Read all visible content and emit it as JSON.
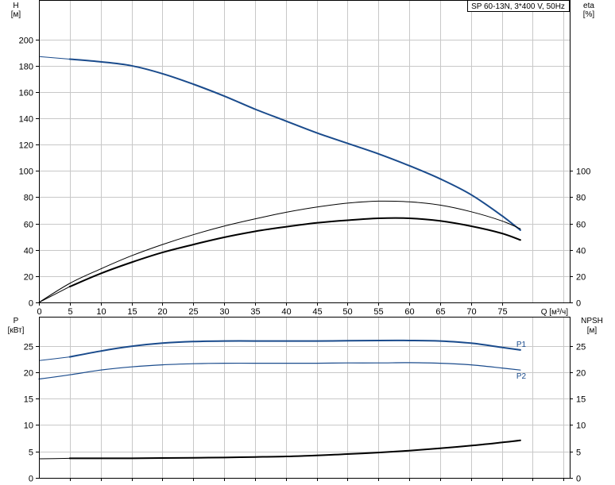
{
  "title": "SP 60-13N, 3*400 V, 50Hz",
  "colors": {
    "blue": "#1a4b8c",
    "black": "#000000",
    "grid": "#c8c8c8"
  },
  "chart_data": [
    {
      "id": "top",
      "type": "line",
      "x_axis": {
        "label": "Q [м³/ч]",
        "range": [
          0,
          86
        ],
        "ticks": [
          0,
          5,
          10,
          15,
          20,
          25,
          30,
          35,
          40,
          45,
          50,
          55,
          60,
          65,
          70,
          75
        ]
      },
      "y_left": {
        "label_line1": "H",
        "label_line2": "[м]",
        "range": [
          0,
          230
        ],
        "ticks": [
          0,
          20,
          40,
          60,
          80,
          100,
          120,
          140,
          160,
          180,
          200
        ]
      },
      "y_right": {
        "label_line1": "eta",
        "label_line2": "[%]",
        "range": [
          0,
          230
        ],
        "ticks": [
          0,
          20,
          40,
          60,
          80,
          100
        ]
      },
      "grid": true,
      "series": [
        {
          "kind": "head",
          "color": "#1a4b8c",
          "width": 2,
          "axis": "left",
          "x": [
            0,
            5,
            10,
            15,
            20,
            25,
            30,
            35,
            40,
            45,
            50,
            55,
            60,
            65,
            70,
            75,
            78
          ],
          "y": [
            187,
            185,
            183,
            180,
            174,
            166,
            157,
            147,
            138,
            129,
            121,
            113,
            104,
            94,
            82,
            66,
            55
          ],
          "x_thin_end": 5
        },
        {
          "kind": "eta_thin",
          "color": "#000000",
          "width": 1,
          "axis": "right",
          "x": [
            0,
            5,
            10,
            15,
            20,
            25,
            30,
            35,
            40,
            45,
            50,
            55,
            60,
            65,
            70,
            75,
            78
          ],
          "y": [
            0,
            14.5,
            25.5,
            35.5,
            44,
            51.5,
            58,
            63.5,
            68.5,
            72.5,
            75.5,
            77,
            76.5,
            74,
            69,
            62,
            56
          ]
        },
        {
          "kind": "eta_thick",
          "color": "#000000",
          "width": 2,
          "axis": "right",
          "x": [
            0,
            5,
            10,
            15,
            20,
            25,
            30,
            35,
            40,
            45,
            50,
            55,
            60,
            65,
            70,
            75,
            78
          ],
          "y": [
            0,
            12,
            22,
            30.5,
            38,
            44,
            49.5,
            54,
            57.5,
            60.5,
            62.5,
            64,
            64,
            62,
            58,
            52.5,
            47.5
          ],
          "x_thin_end": 5
        }
      ]
    },
    {
      "id": "bottom",
      "type": "line",
      "x_axis": {
        "range": [
          0,
          86
        ]
      },
      "y_left": {
        "label_line1": "P",
        "label_line2": "[кВт]",
        "range": [
          0,
          30.5
        ],
        "ticks": [
          0,
          5,
          10,
          15,
          20,
          25
        ]
      },
      "y_right": {
        "label_line1": "NPSH",
        "label_line2": "[м]",
        "range": [
          0,
          30.5
        ],
        "ticks": [
          0,
          5,
          10,
          15,
          20,
          25
        ]
      },
      "grid": true,
      "series": [
        {
          "name": "P1",
          "color": "#1a4b8c",
          "width": 2,
          "axis": "left",
          "x": [
            0,
            5,
            10,
            15,
            20,
            25,
            30,
            35,
            40,
            45,
            50,
            55,
            60,
            65,
            70,
            75,
            78
          ],
          "y": [
            22.2,
            22.9,
            24.0,
            24.9,
            25.5,
            25.8,
            25.9,
            25.9,
            25.9,
            25.9,
            25.95,
            26.0,
            26.0,
            25.9,
            25.5,
            24.7,
            24.2
          ],
          "x_thin_end": 5
        },
        {
          "name": "P2",
          "color": "#1a4b8c",
          "width": 1.2,
          "axis": "left",
          "x": [
            0,
            5,
            10,
            15,
            20,
            25,
            30,
            35,
            40,
            45,
            50,
            55,
            60,
            65,
            70,
            75,
            78
          ],
          "y": [
            18.7,
            19.5,
            20.4,
            21.0,
            21.4,
            21.6,
            21.7,
            21.7,
            21.7,
            21.7,
            21.75,
            21.75,
            21.8,
            21.7,
            21.4,
            20.8,
            20.4
          ]
        },
        {
          "kind": "npsh",
          "color": "#000000",
          "width": 2,
          "axis": "right",
          "x": [
            0,
            5,
            10,
            15,
            20,
            25,
            30,
            35,
            40,
            45,
            50,
            55,
            60,
            65,
            70,
            75,
            78
          ],
          "y": [
            3.6,
            3.7,
            3.7,
            3.7,
            3.75,
            3.8,
            3.85,
            3.95,
            4.05,
            4.25,
            4.5,
            4.8,
            5.15,
            5.6,
            6.1,
            6.7,
            7.1
          ],
          "x_thin_end": 5
        }
      ]
    }
  ]
}
